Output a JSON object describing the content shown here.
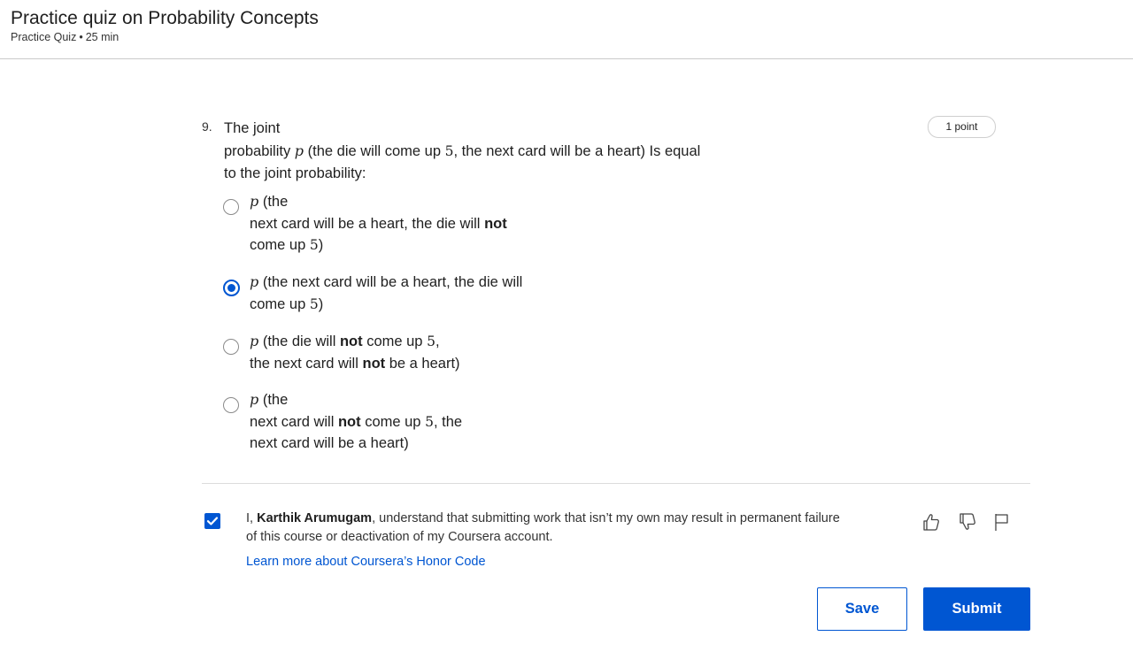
{
  "header": {
    "title": "Practice quiz on Probability Concepts",
    "type": "Practice Quiz",
    "separator": "•",
    "duration": "25 min"
  },
  "question": {
    "number": "9.",
    "points": "1 point",
    "text_a": "The joint",
    "text_b": "probability ",
    "var": "p",
    "text_c": " (the die will come up ",
    "num": "5",
    "text_d": ", the next card will be a heart) Is equal",
    "text_e": "to the joint probability:",
    "options": [
      {
        "var": "p",
        "selected": false,
        "t1": " (the",
        "t2": "next card will be a heart, the die will ",
        "t2_bold": "not",
        "t3": "come up ",
        "num": "5",
        "t3_end": ")"
      },
      {
        "var": "p",
        "selected": true,
        "t1": " (the next card will be a heart, the die will",
        "t2": "come up ",
        "num": "5",
        "t2_end": ")"
      },
      {
        "var": "p",
        "selected": false,
        "t1": " (the die will ",
        "t1_bold": "not",
        "t1_b": " come up ",
        "num": "5",
        "t1_end": ",",
        "t2": "the next card will ",
        "t2_bold": "not",
        "t2_end": " be a heart)"
      },
      {
        "var": "p",
        "selected": false,
        "t1": " (the",
        "t2": "next card will ",
        "t2_bold": "not",
        "t2_b": " come up ",
        "num": "5",
        "t2_end": ", the",
        "t3": "next card will be a heart)"
      }
    ]
  },
  "honor": {
    "checked": true,
    "prefix": "I, ",
    "name": "Karthik Arumugam",
    "statement": ", understand that submitting work that isn’t my own may result in permanent failure of this course or deactivation of my Coursera account.",
    "link": "Learn more about Coursera’s Honor Code"
  },
  "actions": {
    "like_icon": "thumbs-up-icon",
    "dislike_icon": "thumbs-down-icon",
    "report_icon": "flag-icon",
    "save_label": "Save",
    "submit_label": "Submit"
  },
  "colors": {
    "accent": "#0056d2",
    "text": "#1f1f1f",
    "divider": "#dcdcdc"
  }
}
